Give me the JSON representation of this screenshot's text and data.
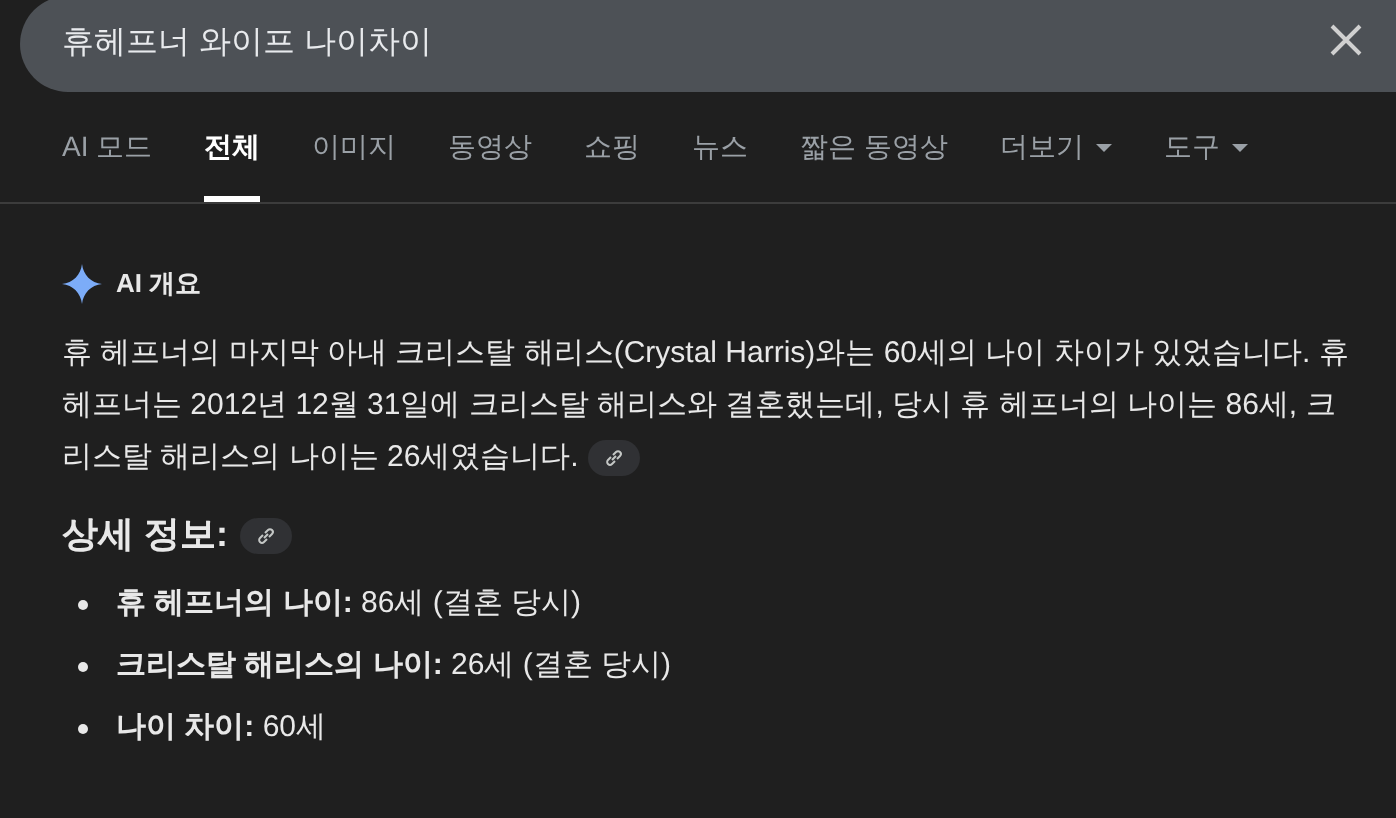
{
  "search": {
    "query": "휴헤프너 와이프 나이차이"
  },
  "tabs": [
    {
      "label": "AI 모드",
      "selected": false,
      "has_menu": false
    },
    {
      "label": "전체",
      "selected": true,
      "has_menu": false
    },
    {
      "label": "이미지",
      "selected": false,
      "has_menu": false
    },
    {
      "label": "동영상",
      "selected": false,
      "has_menu": false
    },
    {
      "label": "쇼핑",
      "selected": false,
      "has_menu": false
    },
    {
      "label": "뉴스",
      "selected": false,
      "has_menu": false
    },
    {
      "label": "짧은 동영상",
      "selected": false,
      "has_menu": false
    },
    {
      "label": "더보기",
      "selected": false,
      "has_menu": true
    },
    {
      "label": "도구",
      "selected": false,
      "has_menu": true
    }
  ],
  "ai_overview": {
    "title": "AI 개요",
    "summary": "휴 헤프너의 마지막 아내 크리스탈 해리스(Crystal Harris)와는 60세의 나이 차이가 있었습니다. 휴 헤프너는 2012년 12월 31일에 크리스탈 해리스와 결혼했는데, 당시 휴 헤프너의 나이는 86세, 크리스탈 해리스의 나이는 26세였습니다.",
    "details_heading": "상세 정보:",
    "details": [
      "**휴 헤프너의 나이:** 86세 (결혼 당시)",
      "**크리스탈 해리스의 나이:** 26세 (결혼 당시)",
      "**나이 차이:** 60세"
    ]
  }
}
